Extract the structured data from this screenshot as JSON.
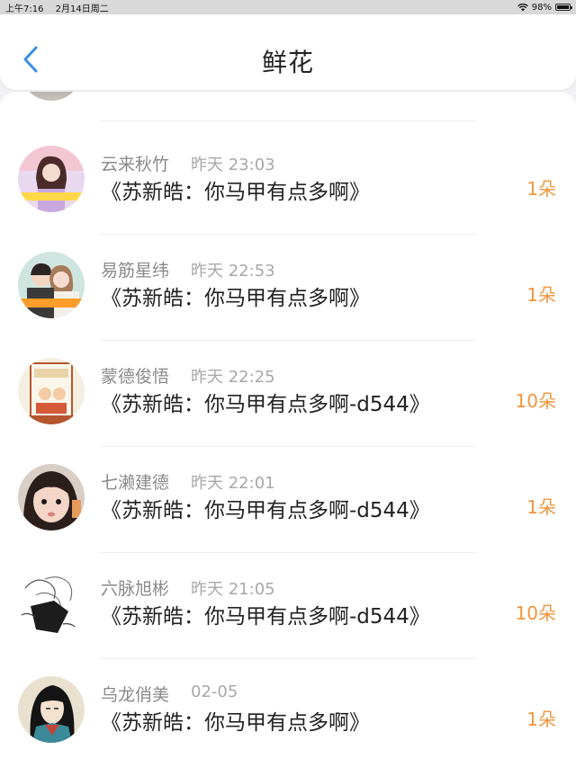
{
  "status_bar": {
    "time": "上午7:16",
    "date": "2月14日周二",
    "battery": "98%",
    "battery_level": 0.98
  },
  "nav": {
    "back_icon": "chevron-left-icon",
    "title": "鲜花"
  },
  "colors": {
    "accent": "#3a8ee6",
    "count": "#f0963d"
  },
  "gifts": [
    {
      "name": "云来秋竹",
      "time": "昨天 23:03",
      "book": "《苏新皓：你马甲有点多啊》",
      "count": "1朵"
    },
    {
      "name": "易筋星纬",
      "time": "昨天 22:53",
      "book": "《苏新皓：你马甲有点多啊》",
      "count": "1朵"
    },
    {
      "name": "蒙德俊悟",
      "time": "昨天 22:25",
      "book": "《苏新皓：你马甲有点多啊-d544》",
      "count": "10朵"
    },
    {
      "name": "七濑建德",
      "time": "昨天 22:01",
      "book": "《苏新皓：你马甲有点多啊-d544》",
      "count": "1朵"
    },
    {
      "name": "六脉旭彬",
      "time": "昨天 21:05",
      "book": "《苏新皓：你马甲有点多啊-d544》",
      "count": "10朵"
    },
    {
      "name": "乌龙俏美",
      "time": "02-05",
      "book": "《苏新皓：你马甲有点多啊》",
      "count": "1朵"
    }
  ]
}
